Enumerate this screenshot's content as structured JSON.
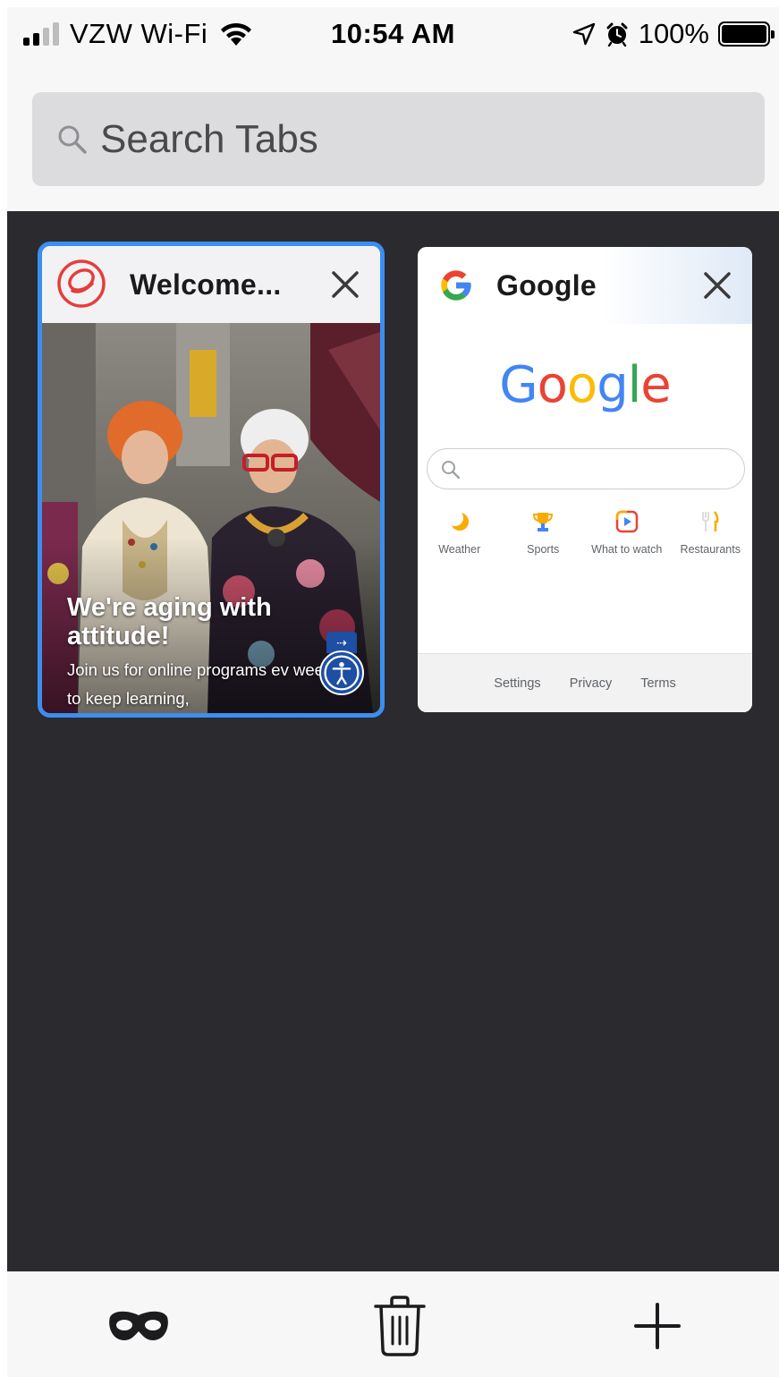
{
  "status_bar": {
    "carrier": "VZW Wi-Fi",
    "time": "10:54 AM",
    "battery_percent": "100%",
    "icons": [
      "signal-icon",
      "wifi-icon",
      "location-arrow-icon",
      "alarm-icon",
      "battery-icon"
    ]
  },
  "search": {
    "placeholder": "Search Tabs",
    "icon": "search-icon"
  },
  "tabs": [
    {
      "title": "Welcome...",
      "favicon": "site-logo-icon",
      "active": true,
      "preview": {
        "headline": "We're aging with\nattitude!",
        "body": "Join us for online programs ev week to keep learning,"
      }
    },
    {
      "title": "Google",
      "favicon": "google-g-icon",
      "active": false,
      "preview": {
        "logo": "Google",
        "shortcuts": [
          {
            "label": "Weather",
            "icon": "weather-icon"
          },
          {
            "label": "Sports",
            "icon": "trophy-icon"
          },
          {
            "label": "What to watch",
            "icon": "play-icon"
          },
          {
            "label": "Restaurants",
            "icon": "fork-knife-icon"
          }
        ],
        "footer": [
          "Settings",
          "Privacy",
          "Terms"
        ]
      }
    }
  ],
  "toolbar": {
    "items": [
      {
        "icon": "private-mask-icon"
      },
      {
        "icon": "trash-icon"
      },
      {
        "icon": "plus-icon"
      }
    ]
  },
  "colors": {
    "active_tab_border": "#3c8ef0",
    "tray_background": "#2a2a2f",
    "google_blue": "#4285F4",
    "google_red": "#EA4335",
    "google_yellow": "#FBBC05",
    "google_green": "#34A853"
  }
}
